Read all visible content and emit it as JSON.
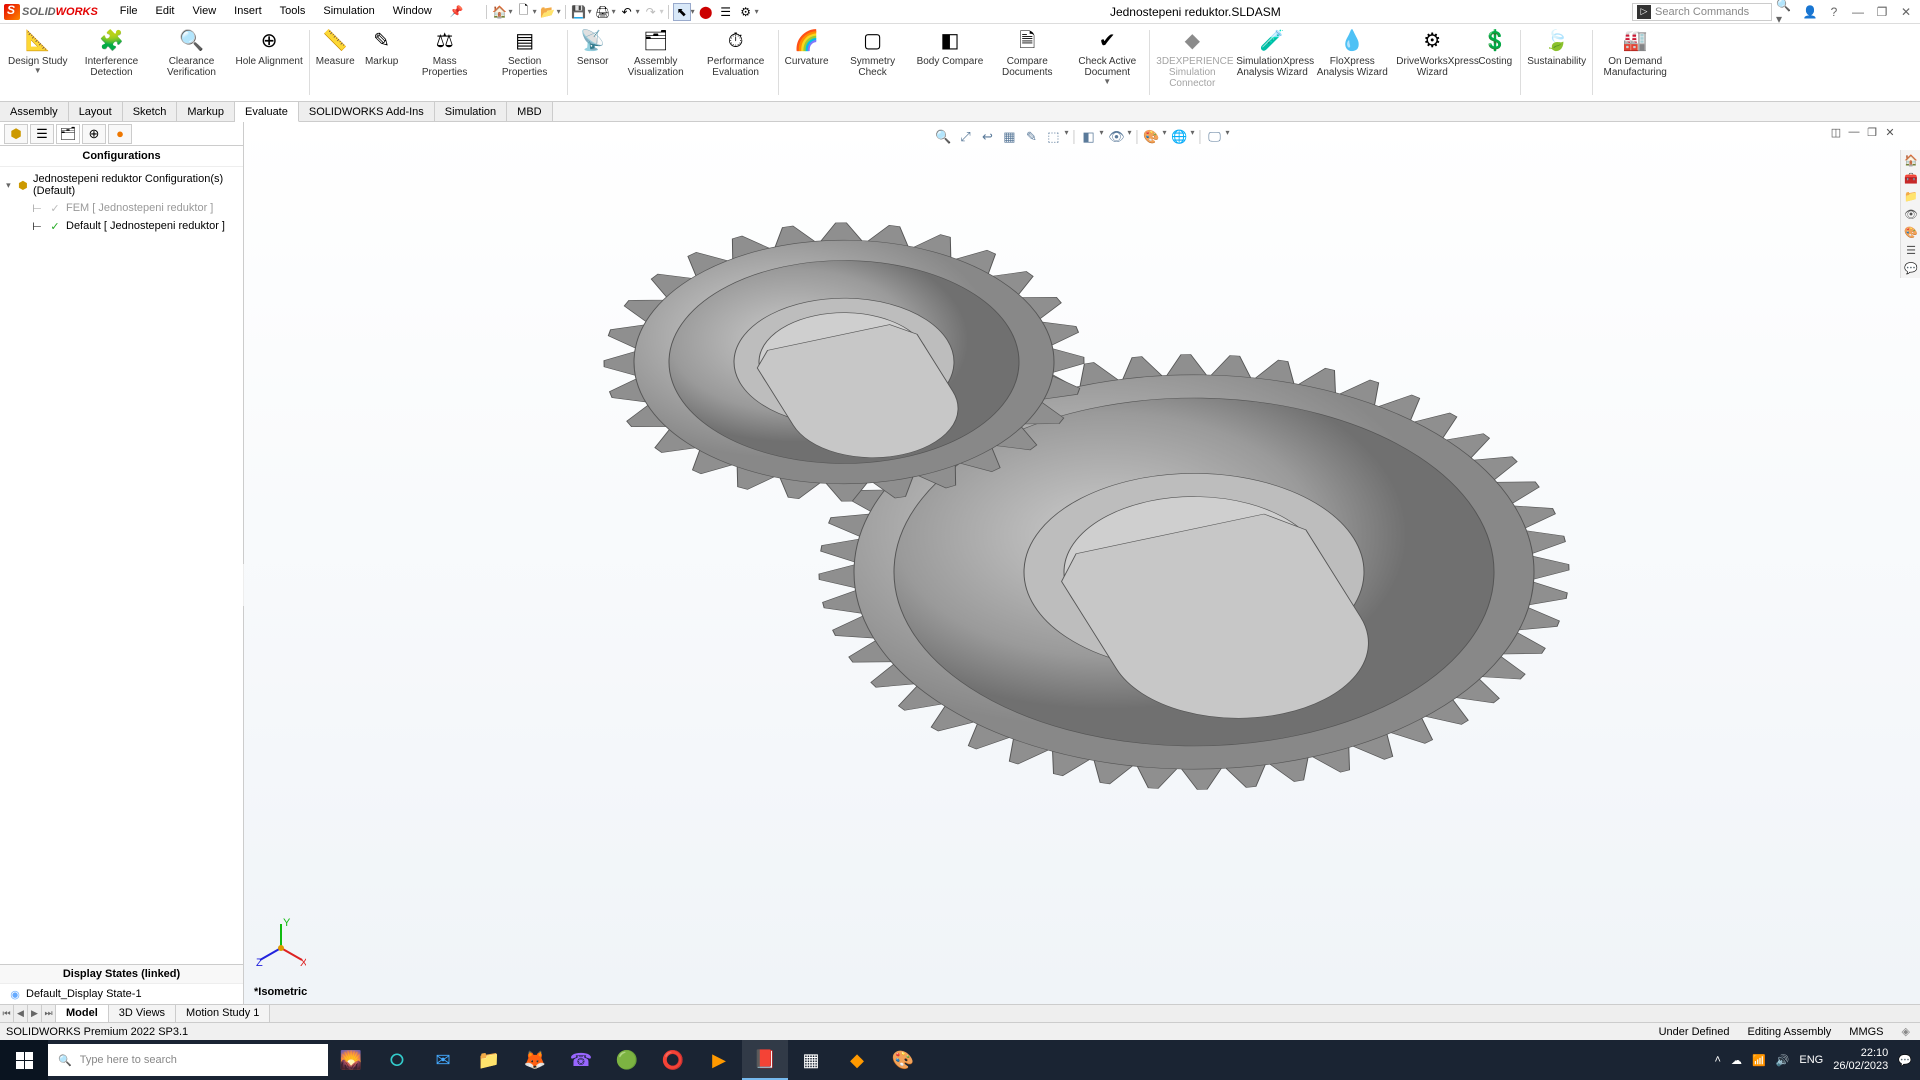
{
  "app": {
    "name_solid": "SOLID",
    "name_works": "WORKS",
    "doc_title": "Jednostepeni reduktor.SLDASM"
  },
  "menu": {
    "items": [
      "File",
      "Edit",
      "View",
      "Insert",
      "Tools",
      "Simulation",
      "Window"
    ]
  },
  "search": {
    "placeholder": "Search Commands"
  },
  "ribbon": {
    "buttons": [
      {
        "label": "Design Study",
        "icon": "📐",
        "dd": true
      },
      {
        "label": "Interference Detection",
        "icon": "🧩"
      },
      {
        "label": "Clearance Verification",
        "icon": "🔍"
      },
      {
        "label": "Hole Alignment",
        "icon": "⊕"
      },
      {
        "label": "Measure",
        "icon": "📏"
      },
      {
        "label": "Markup",
        "icon": "✎"
      },
      {
        "label": "Mass Properties",
        "icon": "⚖"
      },
      {
        "label": "Section Properties",
        "icon": "▤"
      },
      {
        "label": "Sensor",
        "icon": "📡"
      },
      {
        "label": "Assembly Visualization",
        "icon": "🗂"
      },
      {
        "label": "Performance Evaluation",
        "icon": "⏱"
      },
      {
        "label": "Curvature",
        "icon": "🌈"
      },
      {
        "label": "Symmetry Check",
        "icon": "▢"
      },
      {
        "label": "Body Compare",
        "icon": "◧"
      },
      {
        "label": "Compare Documents",
        "icon": "🗎"
      },
      {
        "label": "Check Active Document",
        "icon": "✔",
        "dd": true
      },
      {
        "label": "3DEXPERIENCE Simulation Connector",
        "icon": "◆",
        "disabled": true
      },
      {
        "label": "SimulationXpress Analysis Wizard",
        "icon": "🧪"
      },
      {
        "label": "FloXpress Analysis Wizard",
        "icon": "💧"
      },
      {
        "label": "DriveWorksXpress Wizard",
        "icon": "⚙"
      },
      {
        "label": "Costing",
        "icon": "💲"
      },
      {
        "label": "Sustainability",
        "icon": "🍃"
      },
      {
        "label": "On Demand Manufacturing",
        "icon": "🏭"
      }
    ]
  },
  "tabs": {
    "items": [
      "Assembly",
      "Layout",
      "Sketch",
      "Markup",
      "Evaluate",
      "SOLIDWORKS Add-Ins",
      "Simulation",
      "MBD"
    ],
    "active": "Evaluate"
  },
  "configs": {
    "header": "Configurations",
    "root": "Jednostepeni reduktor Configuration(s)  (Default)",
    "children": [
      {
        "label": "FEM [ Jednostepeni reduktor ]",
        "muted": true
      },
      {
        "label": "Default [ Jednostepeni reduktor ]",
        "check": true
      }
    ],
    "display_header": "Display States (linked)",
    "display_state": "Default_Display State-1"
  },
  "view": {
    "label": "*Isometric"
  },
  "doc_tabs": {
    "items": [
      "Model",
      "3D Views",
      "Motion Study 1"
    ],
    "active": "Model"
  },
  "status": {
    "left": "SOLIDWORKS Premium 2022 SP3.1",
    "defined": "Under Defined",
    "editing": "Editing Assembly",
    "units": "MMGS"
  },
  "taskbar": {
    "search": "Type here to search",
    "lang": "ENG",
    "time": "22:10",
    "date": "26/02/2023"
  }
}
